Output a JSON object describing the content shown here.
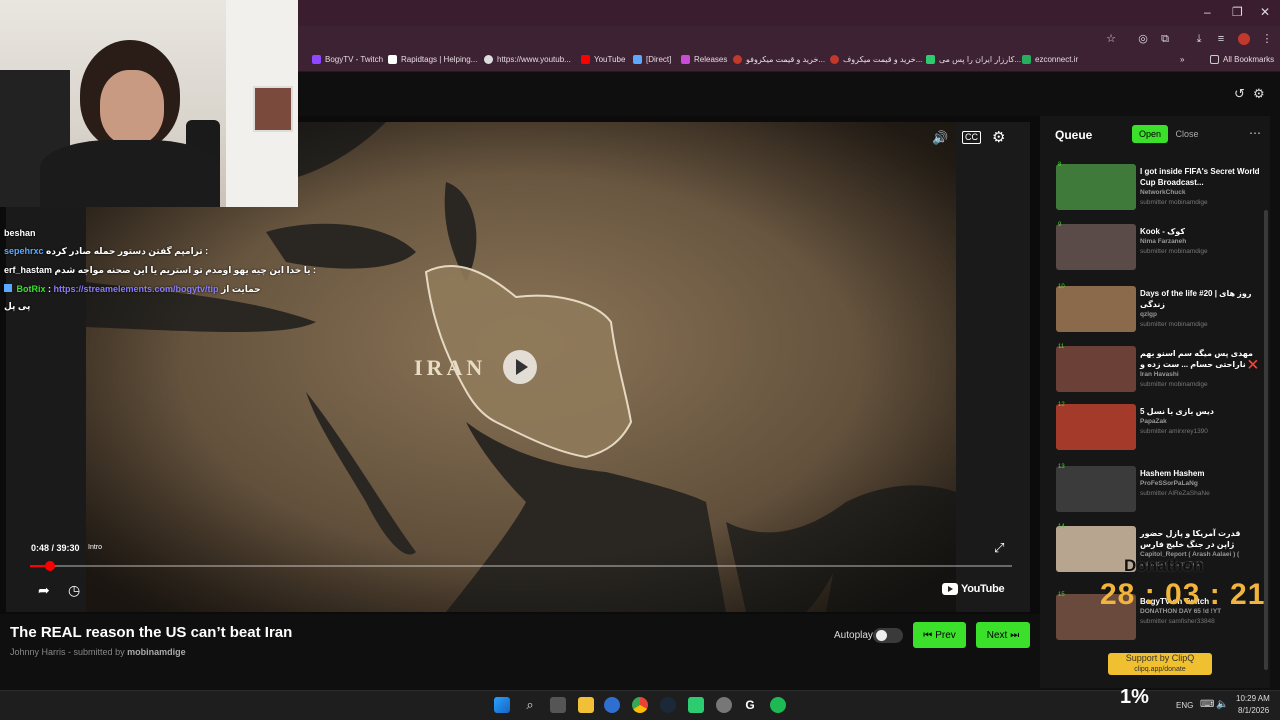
{
  "browser": {
    "bookmarks": [
      {
        "label": "BogyTV - Twitch",
        "color": "#9146ff"
      },
      {
        "label": "Rapidtags | Helping...",
        "color": "#ffffff"
      },
      {
        "label": "https://www.youtub...",
        "color": "#dddddd"
      },
      {
        "label": "YouTube",
        "color": "#ff0000"
      },
      {
        "label": "[Direct]",
        "color": "#5aa9ff"
      },
      {
        "label": "Releases",
        "color": "#c94bd6"
      },
      {
        "label": "خرید و قیمت میکروفو...",
        "color": "#c0392b"
      },
      {
        "label": "خرید و قیمت میکروف...",
        "color": "#c0392b"
      },
      {
        "label": "کارزار ایران را پس می...",
        "color": "#2ecc71"
      },
      {
        "label": "ezconnect.ir",
        "color": "#27ae60"
      }
    ],
    "all_bookmarks": "All Bookmarks",
    "window_controls": [
      "–",
      "❐",
      "✕"
    ]
  },
  "player": {
    "time": "0:48 / 39:30",
    "chapter": "Intro",
    "progress_fraction": 0.0203,
    "map_label": "IRAN",
    "brand": "YouTube"
  },
  "video": {
    "title": "The REAL reason the US can’t beat Iran",
    "channel": "Johnny Harris",
    "submitted_prefix": "- submitted by",
    "submitter": "mobinamdige"
  },
  "controls": {
    "autoplay_label": "Autoplay",
    "autoplay_on": false,
    "prev_label": "Prev",
    "next_label": "Next"
  },
  "queue": {
    "title": "Queue",
    "open_label": "Open",
    "close_label": "Close",
    "items": [
      {
        "num": "8",
        "title": "I got inside FIFA's Secret World Cup Broadcast...",
        "channel": "NetworkChuck",
        "submitter": "submitter mobinamdige",
        "thumb": "#3f7a3a"
      },
      {
        "num": "9",
        "title": "Kook - کوک",
        "channel": "Nima Farzaneh",
        "submitter": "submitter mobinamdige",
        "thumb": "#5a4a48"
      },
      {
        "num": "10",
        "title": "Days of the life #20 | روز های زندگی",
        "channel": "qzlgp",
        "submitter": "submitter mobinamdige",
        "thumb": "#8a6a4a"
      },
      {
        "num": "11",
        "title": "مهدی پس میگه سم اسنو بهم ❌ ناراحتی حسام ... ست زده و",
        "channel": "Iran Havashi",
        "submitter": "submitter mobinamdige",
        "thumb": "#6b4036"
      },
      {
        "num": "12",
        "title": "دیس بازی با نسل 5",
        "channel": "PapaZak",
        "submitter": "submitter amirxrey1390",
        "thumb": "#a33a2a"
      },
      {
        "num": "13",
        "title": "Hashem Hashem",
        "channel": "ProFeSSorPaLaNg",
        "submitter": "submitter AlReZaShaNe",
        "thumb": "#3b3b3b"
      },
      {
        "num": "14",
        "title": "قدرت آمریکا و پازل حضور ژاپن در جنگ خلیج فارس",
        "channel": "Capitol_Report ( Arash Aalaei ) (",
        "submitter": "submitter Kosm_Feli2",
        "thumb": "#b8a590"
      },
      {
        "num": "15",
        "title": "BogyTV on Twitch",
        "channel": "DONATHON DAY 65 !d !YT",
        "submitter": "submitter samfisher33848",
        "thumb": "#6a4a3c"
      }
    ]
  },
  "stream_overlay": {
    "chat": [
      {
        "user": "beshan",
        "color": "#ffffff",
        "text": ""
      },
      {
        "user": "sepehrxc",
        "color": "#5aa9ff",
        "text": "ترامپم گفتن دستور حمله صادر کرده :"
      },
      {
        "user": "erf_hastam",
        "color": "#ffffff",
        "text": "یا خدا این چیه یهو اومدم تو استریم یا این صحنه مواجه شدم :"
      },
      {
        "user": "BotRix",
        "color": "#3be02b",
        "text": "https://streamelements.com/bogytv/tip",
        "suffix": "حمایت از"
      },
      {
        "user": "",
        "color": "#ffffff",
        "text": "پی پل"
      }
    ],
    "donathon_label": "Donathon",
    "donathon_timer": "28 : 03 : 21",
    "clipq_line1": "Support by ClipQ",
    "clipq_line2": "clipq.app/donate",
    "percent": "1%"
  },
  "taskbar": {
    "lang": "ENG",
    "time": "10:29 AM",
    "date": "8/1/2026"
  }
}
